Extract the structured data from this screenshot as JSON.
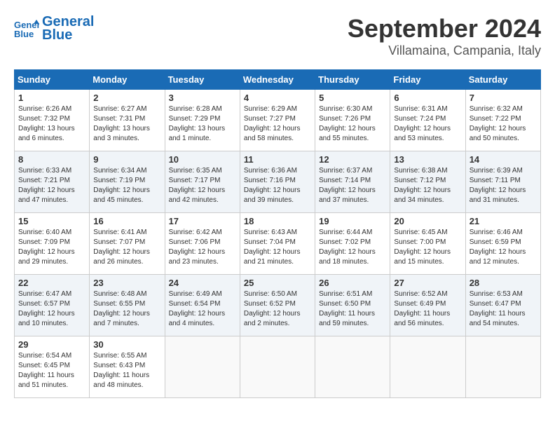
{
  "header": {
    "logo_line1": "General",
    "logo_line2": "Blue",
    "month": "September 2024",
    "location": "Villamaina, Campania, Italy"
  },
  "weekdays": [
    "Sunday",
    "Monday",
    "Tuesday",
    "Wednesday",
    "Thursday",
    "Friday",
    "Saturday"
  ],
  "weeks": [
    [
      {
        "day": "1",
        "info": "Sunrise: 6:26 AM\nSunset: 7:32 PM\nDaylight: 13 hours\nand 6 minutes."
      },
      {
        "day": "2",
        "info": "Sunrise: 6:27 AM\nSunset: 7:31 PM\nDaylight: 13 hours\nand 3 minutes."
      },
      {
        "day": "3",
        "info": "Sunrise: 6:28 AM\nSunset: 7:29 PM\nDaylight: 13 hours\nand 1 minute."
      },
      {
        "day": "4",
        "info": "Sunrise: 6:29 AM\nSunset: 7:27 PM\nDaylight: 12 hours\nand 58 minutes."
      },
      {
        "day": "5",
        "info": "Sunrise: 6:30 AM\nSunset: 7:26 PM\nDaylight: 12 hours\nand 55 minutes."
      },
      {
        "day": "6",
        "info": "Sunrise: 6:31 AM\nSunset: 7:24 PM\nDaylight: 12 hours\nand 53 minutes."
      },
      {
        "day": "7",
        "info": "Sunrise: 6:32 AM\nSunset: 7:22 PM\nDaylight: 12 hours\nand 50 minutes."
      }
    ],
    [
      {
        "day": "8",
        "info": "Sunrise: 6:33 AM\nSunset: 7:21 PM\nDaylight: 12 hours\nand 47 minutes."
      },
      {
        "day": "9",
        "info": "Sunrise: 6:34 AM\nSunset: 7:19 PM\nDaylight: 12 hours\nand 45 minutes."
      },
      {
        "day": "10",
        "info": "Sunrise: 6:35 AM\nSunset: 7:17 PM\nDaylight: 12 hours\nand 42 minutes."
      },
      {
        "day": "11",
        "info": "Sunrise: 6:36 AM\nSunset: 7:16 PM\nDaylight: 12 hours\nand 39 minutes."
      },
      {
        "day": "12",
        "info": "Sunrise: 6:37 AM\nSunset: 7:14 PM\nDaylight: 12 hours\nand 37 minutes."
      },
      {
        "day": "13",
        "info": "Sunrise: 6:38 AM\nSunset: 7:12 PM\nDaylight: 12 hours\nand 34 minutes."
      },
      {
        "day": "14",
        "info": "Sunrise: 6:39 AM\nSunset: 7:11 PM\nDaylight: 12 hours\nand 31 minutes."
      }
    ],
    [
      {
        "day": "15",
        "info": "Sunrise: 6:40 AM\nSunset: 7:09 PM\nDaylight: 12 hours\nand 29 minutes."
      },
      {
        "day": "16",
        "info": "Sunrise: 6:41 AM\nSunset: 7:07 PM\nDaylight: 12 hours\nand 26 minutes."
      },
      {
        "day": "17",
        "info": "Sunrise: 6:42 AM\nSunset: 7:06 PM\nDaylight: 12 hours\nand 23 minutes."
      },
      {
        "day": "18",
        "info": "Sunrise: 6:43 AM\nSunset: 7:04 PM\nDaylight: 12 hours\nand 21 minutes."
      },
      {
        "day": "19",
        "info": "Sunrise: 6:44 AM\nSunset: 7:02 PM\nDaylight: 12 hours\nand 18 minutes."
      },
      {
        "day": "20",
        "info": "Sunrise: 6:45 AM\nSunset: 7:00 PM\nDaylight: 12 hours\nand 15 minutes."
      },
      {
        "day": "21",
        "info": "Sunrise: 6:46 AM\nSunset: 6:59 PM\nDaylight: 12 hours\nand 12 minutes."
      }
    ],
    [
      {
        "day": "22",
        "info": "Sunrise: 6:47 AM\nSunset: 6:57 PM\nDaylight: 12 hours\nand 10 minutes."
      },
      {
        "day": "23",
        "info": "Sunrise: 6:48 AM\nSunset: 6:55 PM\nDaylight: 12 hours\nand 7 minutes."
      },
      {
        "day": "24",
        "info": "Sunrise: 6:49 AM\nSunset: 6:54 PM\nDaylight: 12 hours\nand 4 minutes."
      },
      {
        "day": "25",
        "info": "Sunrise: 6:50 AM\nSunset: 6:52 PM\nDaylight: 12 hours\nand 2 minutes."
      },
      {
        "day": "26",
        "info": "Sunrise: 6:51 AM\nSunset: 6:50 PM\nDaylight: 11 hours\nand 59 minutes."
      },
      {
        "day": "27",
        "info": "Sunrise: 6:52 AM\nSunset: 6:49 PM\nDaylight: 11 hours\nand 56 minutes."
      },
      {
        "day": "28",
        "info": "Sunrise: 6:53 AM\nSunset: 6:47 PM\nDaylight: 11 hours\nand 54 minutes."
      }
    ],
    [
      {
        "day": "29",
        "info": "Sunrise: 6:54 AM\nSunset: 6:45 PM\nDaylight: 11 hours\nand 51 minutes."
      },
      {
        "day": "30",
        "info": "Sunrise: 6:55 AM\nSunset: 6:43 PM\nDaylight: 11 hours\nand 48 minutes."
      },
      {
        "day": "",
        "info": ""
      },
      {
        "day": "",
        "info": ""
      },
      {
        "day": "",
        "info": ""
      },
      {
        "day": "",
        "info": ""
      },
      {
        "day": "",
        "info": ""
      }
    ]
  ]
}
